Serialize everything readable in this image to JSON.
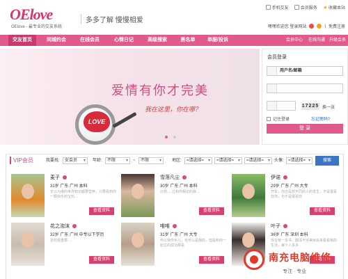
{
  "header": {
    "logo": "OElove",
    "logo_sub": "OElove - 最专业的交友系统",
    "slogan": "多多了解  慢慢相爱",
    "top_links": [
      "手机交友",
      "会员服务",
      "收藏本站"
    ],
    "welcome": "嘿嘿欢迎您  登录网站",
    "register": "免费注册"
  },
  "nav": {
    "items": [
      "交友首页",
      "同城约会",
      "在线会员",
      "心情日记",
      "高级搜索",
      "黑名单",
      "单服/投诉"
    ],
    "right_links": [
      "会员中心",
      "在线沟通",
      "升级会员"
    ]
  },
  "banner": {
    "title": "爱情有你才完美",
    "subtitle": "我在这里，你在哪？",
    "heart_text": "LOVE"
  },
  "login": {
    "title": "会员登录",
    "username_placeholder": "用户名/邮箱",
    "captcha": "17225",
    "refresh": "换一张",
    "remember": "记住登录",
    "forgot": "忘记密码?",
    "submit": "登 录"
  },
  "vip": {
    "title": "VIP会员",
    "filters": {
      "seek_label": "我要找:",
      "seek_value": "女会员",
      "age_label": "年龄:",
      "age_from": "不限",
      "age_sep": "~",
      "age_to": "不限",
      "region_label": "地区:",
      "region1": "=请选择=",
      "region2": "=请选择=",
      "region3": "=请选择=",
      "photo_label": "头像:",
      "photo_value": "=请选择=",
      "search": "搜索"
    },
    "members": [
      {
        "name": "麦子",
        "info": "31岁  广东  广州  本科",
        "desc": "无以为继的世界知识都要营养，只要看到你一颗快乐的宝石....",
        "btn": "查看资料"
      },
      {
        "name": "雪落凡尘",
        "info": "30岁  广东  广州  本科",
        "desc": "只想.....过和你相识的我...",
        "btn": "查看资料"
      },
      {
        "name": "伊诺",
        "info": "29岁  广东  广州  大专",
        "desc": "开车，你还是想不同的人的发生，不是很喜欢你，也不是很喜欢",
        "btn": "查看资料"
      },
      {
        "name": "花之泡沫",
        "info": "32岁  广东  广州  中专以下学历",
        "desc": "爱的很重要.....",
        "btn": "查看资料"
      },
      {
        "name": "唯唯",
        "info": "31岁  广东  广州  大专",
        "desc": "你以我你手儿，也可以是我的，但是和你一起往的成功那是",
        "btn": "查看资料"
      },
      {
        "name": "叶子",
        "info": "36岁  广东  深圳  本科",
        "desc": "现在我一本书，翻译不完美就会来看看我的生活，每个人多多",
        "btn": "查看资料"
      }
    ]
  },
  "watermark": {
    "title": "南充电脑维修",
    "sub": "专注 · 专业"
  },
  "colors": {
    "brand": "#e05a8b",
    "button": "#d83f6c",
    "search": "#3b75c4"
  }
}
